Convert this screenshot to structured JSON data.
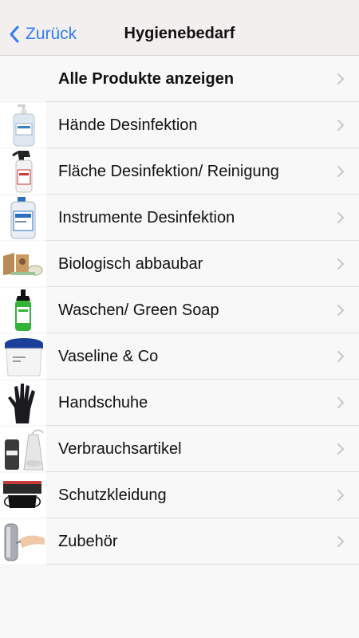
{
  "nav": {
    "back_label": "Zurück",
    "title": "Hygienebedarf"
  },
  "colors": {
    "accent": "#2f7cf6",
    "nav_background": "#f3efef",
    "list_background": "#f8f8f8",
    "separator": "#dddddd",
    "chevron": "#c7c7cc"
  },
  "list": {
    "items": [
      {
        "label": "Alle Produkte anzeigen",
        "thumb": "none"
      },
      {
        "label": "Hände Desinfektion",
        "thumb": "pump-bottle-image"
      },
      {
        "label": "Fläche Desinfektion/ Reinigung",
        "thumb": "spray-bottle-image"
      },
      {
        "label": "Instrumente Desinfektion",
        "thumb": "canister-image"
      },
      {
        "label": "Biologisch abbaubar",
        "thumb": "paper-products-image"
      },
      {
        "label": "Waschen/ Green Soap",
        "thumb": "green-soap-bottle-image"
      },
      {
        "label": "Vaseline & Co",
        "thumb": "vaseline-tub-image"
      },
      {
        "label": "Handschuhe",
        "thumb": "black-glove-image"
      },
      {
        "label": "Verbrauchsartikel",
        "thumb": "consumables-image"
      },
      {
        "label": "Schutzkleidung",
        "thumb": "face-masks-box-image"
      },
      {
        "label": "Zubehör",
        "thumb": "soap-dispenser-image"
      }
    ]
  }
}
